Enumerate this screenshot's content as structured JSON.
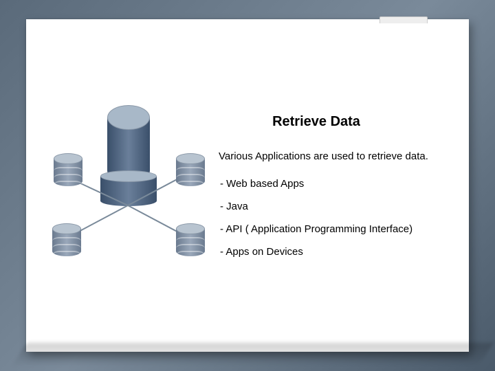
{
  "slide": {
    "title": "Retrieve Data",
    "intro": "Various Applications are used to retrieve data.",
    "bullets": [
      "Web based Apps",
      "Java",
      "API ( Application Programming Interface)",
      "Apps on Devices"
    ]
  }
}
